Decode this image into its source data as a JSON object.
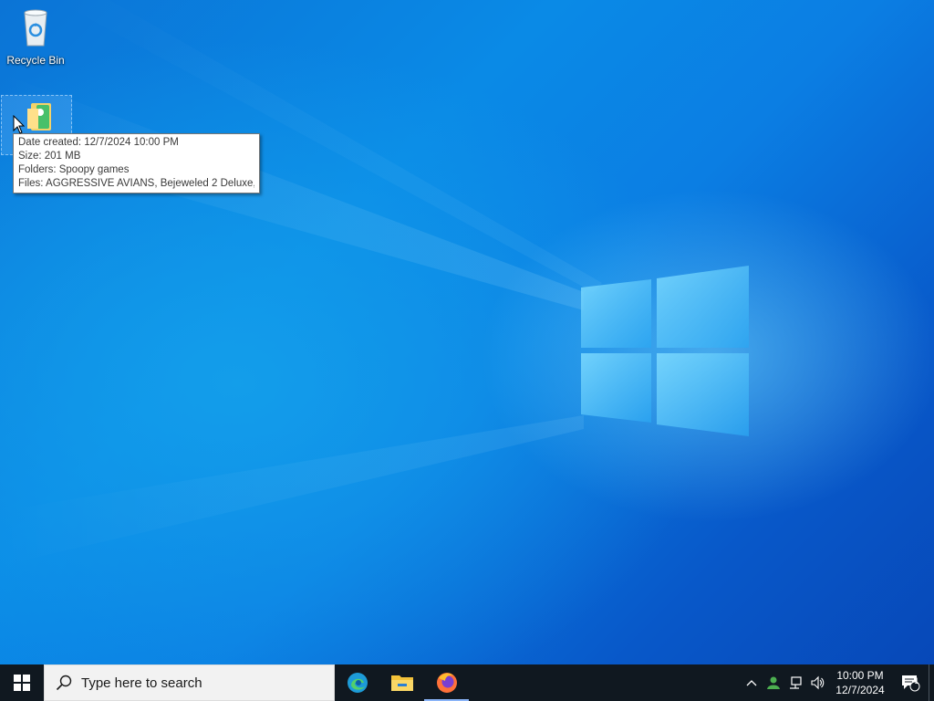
{
  "desktop": {
    "icons": [
      {
        "name": "recycle-bin",
        "label": "Recycle Bin"
      },
      {
        "name": "games-folder",
        "label": ""
      }
    ]
  },
  "tooltip": {
    "lines": [
      "Date created: 12/7/2024 10:00 PM",
      "Size: 201 MB",
      "Folders: Spoopy games",
      "Files: AGGRESSIVE AVIANS, Bejeweled 2 Deluxe, ..."
    ]
  },
  "taskbar": {
    "search_placeholder": "Type here to search",
    "apps": [
      {
        "name": "edge-icon"
      },
      {
        "name": "file-explorer-icon"
      },
      {
        "name": "firefox-icon"
      }
    ],
    "tray": {
      "time": "10:00 PM",
      "date": "12/7/2024",
      "notification_count": "1"
    }
  },
  "colors": {
    "wallpaper_primary": "#0a6fd8",
    "taskbar": "#101820",
    "search_bg": "#f2f2f2"
  }
}
